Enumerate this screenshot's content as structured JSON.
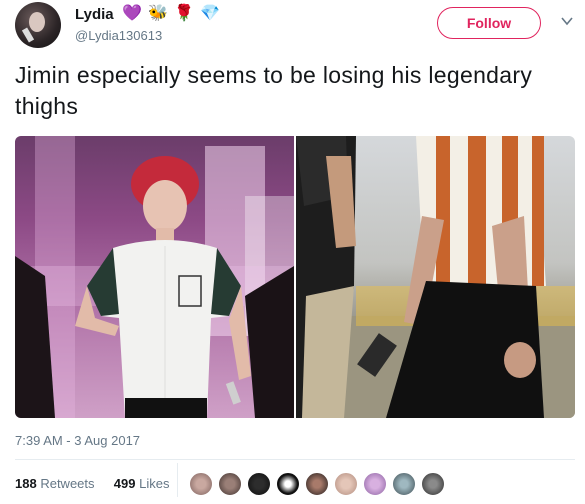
{
  "user": {
    "name": "Lydia",
    "handle": "@Lydia130613",
    "name_emojis": [
      "💜",
      "🐝",
      "🌹",
      "💎"
    ]
  },
  "follow_label": "Follow",
  "tweet_text": "Jimin especially seems to be losing his legendary thighs",
  "timestamp": "7:39 AM - 3 Aug 2017",
  "stats": {
    "retweets_count": "188",
    "retweets_label": "Retweets",
    "likes_count": "499",
    "likes_label": "Likes"
  },
  "colors": {
    "accent": "#e0245e",
    "secondary_text": "#657786",
    "divider": "#e6ecf0"
  },
  "icons": [
    "chevron-down-icon"
  ]
}
